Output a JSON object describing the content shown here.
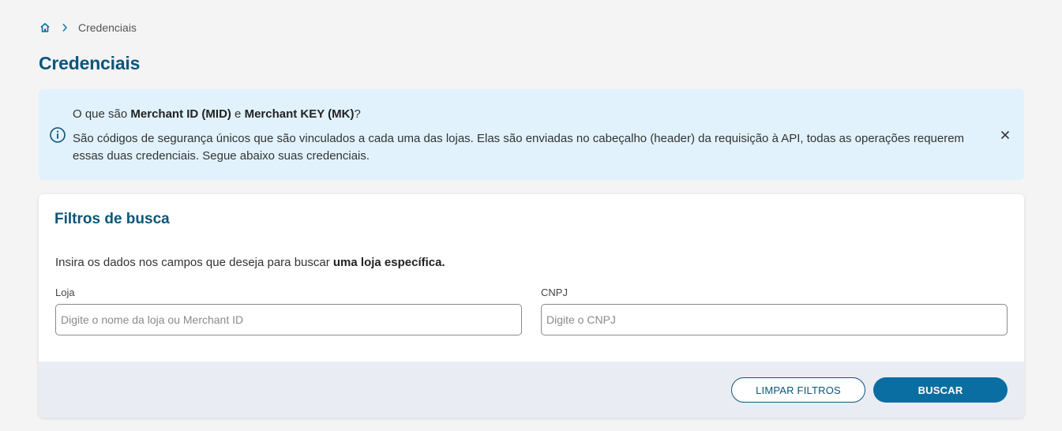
{
  "breadcrumb": {
    "home_icon": "home-icon",
    "separator_icon": "chevron-right-icon",
    "current": "Credenciais"
  },
  "page": {
    "title": "Credenciais"
  },
  "info_banner": {
    "icon": "info-icon",
    "title_prefix": "O que são ",
    "title_mid": "Merchant ID (MID)",
    "title_and": " e ",
    "title_mk": "Merchant KEY (MK)",
    "title_suffix": "?",
    "body": "São códigos de segurança únicos que são vinculados a cada uma das lojas. Elas são enviadas no cabeçalho (header) da requisição à API, todas as operações requerem essas duas credenciais. Segue abaixo suas credenciais.",
    "close_icon": "close-icon"
  },
  "filters": {
    "title": "Filtros de busca",
    "description_prefix": "Insira os dados nos campos que deseja para buscar ",
    "description_bold": "uma loja específica.",
    "store_label": "Loja",
    "store_placeholder": "Digite o nome da loja ou Merchant ID",
    "store_value": "",
    "cnpj_label": "CNPJ",
    "cnpj_placeholder": "Digite o CNPJ",
    "cnpj_value": "",
    "clear_button": "LIMPAR FILTROS",
    "search_button": "BUSCAR"
  },
  "colors": {
    "primary": "#0b5579",
    "button_primary": "#0a6ea3",
    "banner_bg": "#e1f2fc",
    "footer_bg": "#e9edf3",
    "page_bg": "#f4f4f4"
  }
}
